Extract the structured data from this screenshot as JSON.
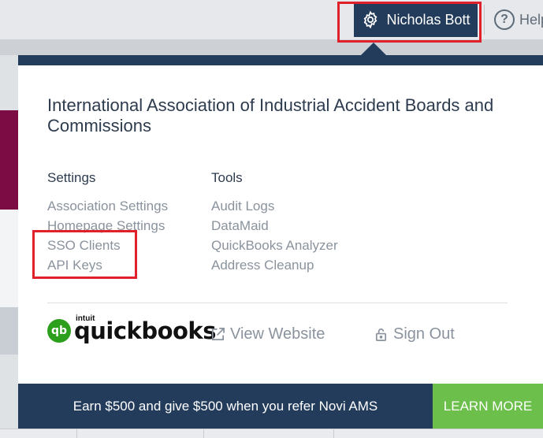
{
  "header": {
    "user_name": "Nicholas Bott",
    "help_label": "Help"
  },
  "dropdown": {
    "organization": "International Association of Industrial Accident Boards and Commissions",
    "settings": {
      "heading": "Settings",
      "items": [
        "Association Settings",
        "Homepage Settings",
        "SSO Clients",
        "API Keys"
      ]
    },
    "tools": {
      "heading": "Tools",
      "items": [
        "Audit Logs",
        "DataMaid",
        "QuickBooks Analyzer",
        "Address Cleanup"
      ]
    },
    "quickbooks": {
      "brand_small": "intuit",
      "brand_word": "quickbooks",
      "icon_glyph": "qb"
    },
    "view_website": "View Website",
    "sign_out": "Sign Out",
    "promo_text": "Earn $500 and give $500 when you refer Novi AMS",
    "learn_more": "LEARN MORE"
  },
  "colors": {
    "navy": "#243c5c",
    "green": "#6cbf4b",
    "quickbooks_green": "#2ca01c",
    "highlight_red": "#e0202a",
    "muted_text": "#8a939d"
  },
  "icons": {
    "user_button": "gear-icon",
    "help": "question-circle-icon",
    "view_website": "external-link-icon",
    "sign_out": "lock-icon"
  }
}
